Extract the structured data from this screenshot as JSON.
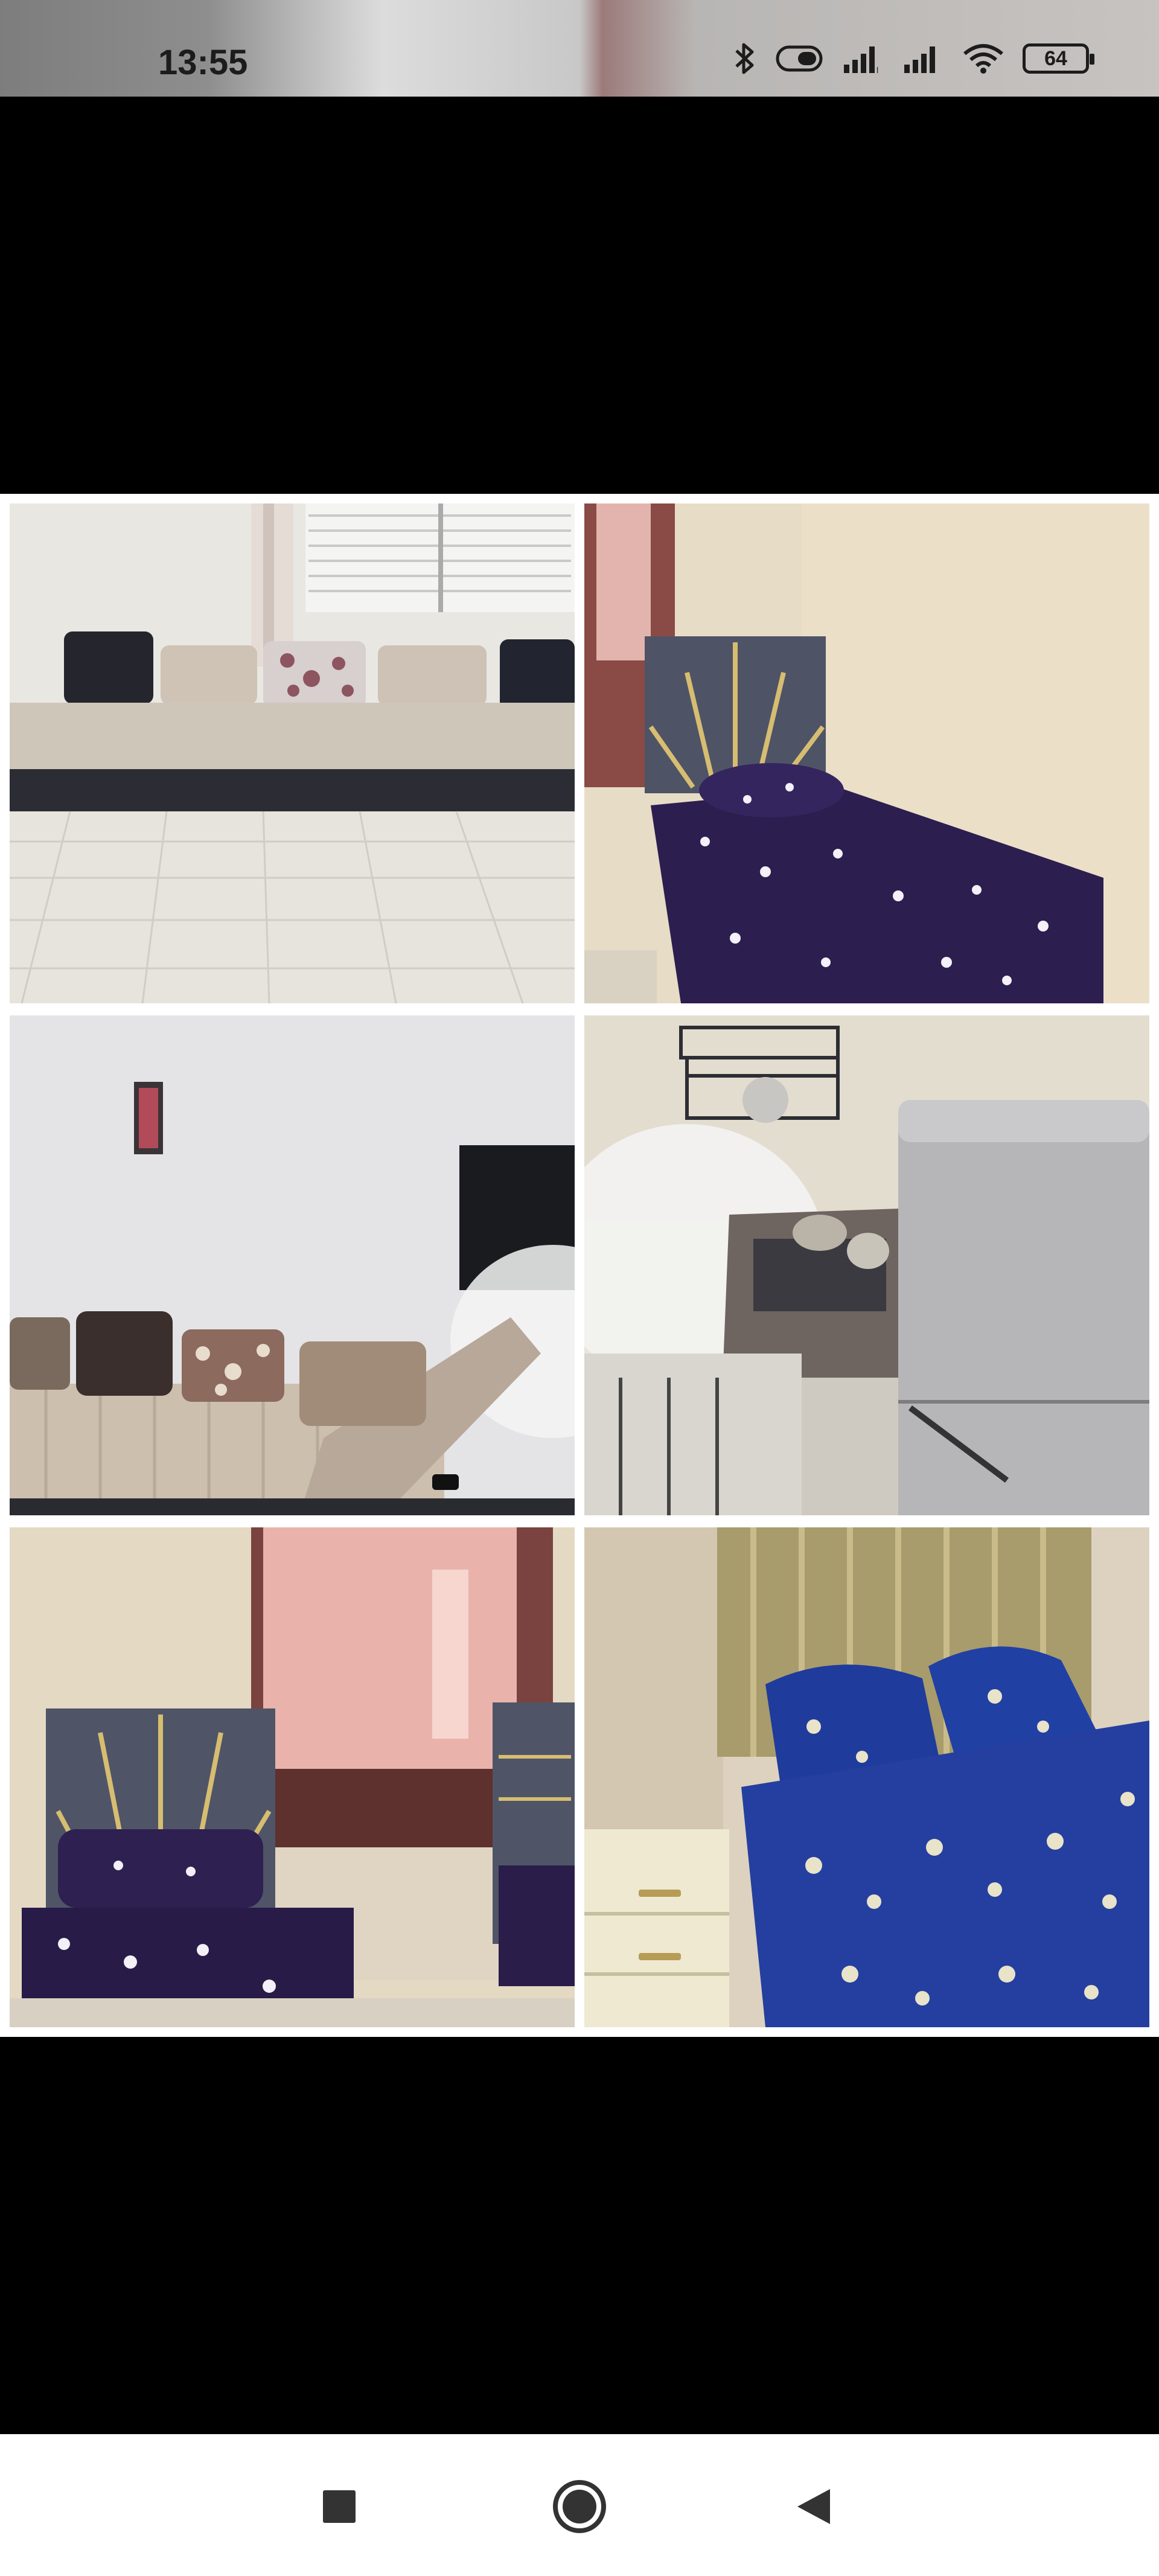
{
  "status_bar": {
    "time": "13:55",
    "battery_level": "64",
    "icons": [
      "bluetooth-icon",
      "toggle-icon",
      "signal-icon",
      "signal-icon",
      "wifi-icon",
      "battery-icon"
    ]
  },
  "gallery": {
    "photos": [
      {
        "name": "living-room-sofa-photo"
      },
      {
        "name": "single-bed-photo"
      },
      {
        "name": "salon-tv-photo"
      },
      {
        "name": "kitchen-photo"
      },
      {
        "name": "single-bed-window-photo"
      },
      {
        "name": "double-bed-photo"
      }
    ]
  },
  "navigation": {
    "buttons": [
      "recents-button",
      "home-button",
      "back-button"
    ]
  },
  "colors": {
    "background": "#000000",
    "collage_border": "#ffffff",
    "nav_icon": "#333333"
  }
}
